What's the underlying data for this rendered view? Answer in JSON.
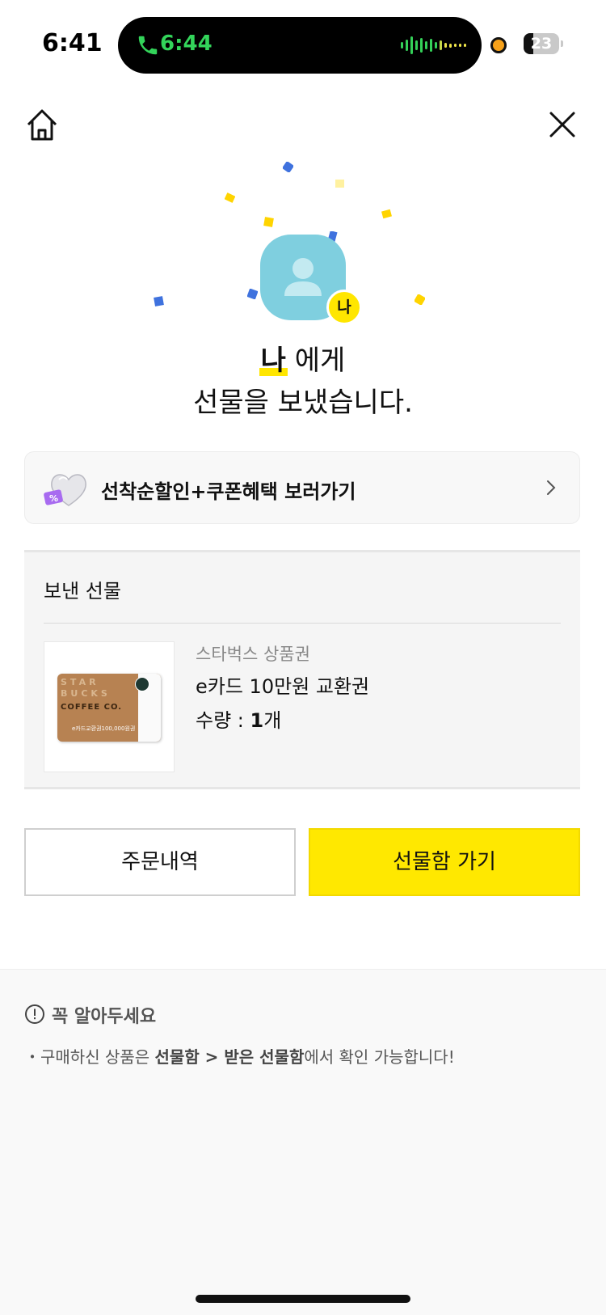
{
  "status_bar": {
    "time": "6:41",
    "call_time": "6:44",
    "battery_level": "23",
    "call_color": "#33d45a"
  },
  "nav": {
    "home_icon": "home-icon",
    "close_icon": "close-icon"
  },
  "recipient": {
    "badge": "나",
    "name": "나",
    "to_suffix": " 에게",
    "sent_message": "선물을 보냈습니다."
  },
  "promo": {
    "label": "선착순할인+쿠폰혜택 보러가기",
    "icon": "heart-coupon-icon"
  },
  "sent_gift": {
    "section_title": "보낸 선물",
    "brand": "스타벅스 상품권",
    "product_name": "e카드 10만원 교환권",
    "quantity_label": "수량 : ",
    "quantity_value": "1",
    "quantity_unit": "개",
    "card_text": {
      "line1": "STAR",
      "line2": "BUCKS",
      "line3": "COFFEE CO.",
      "amount": "e카드교환권100,000원권"
    }
  },
  "buttons": {
    "order_history": "주문내역",
    "go_giftbox": "선물함 가기",
    "accent": "#ffe800"
  },
  "notice": {
    "title": "꼭 알아두세요",
    "bullet": "・",
    "text_1": "구매하신 상품은 ",
    "bold_1": "선물함 > 받은 선물함",
    "text_2": "에서 확인 가능합니다!"
  }
}
